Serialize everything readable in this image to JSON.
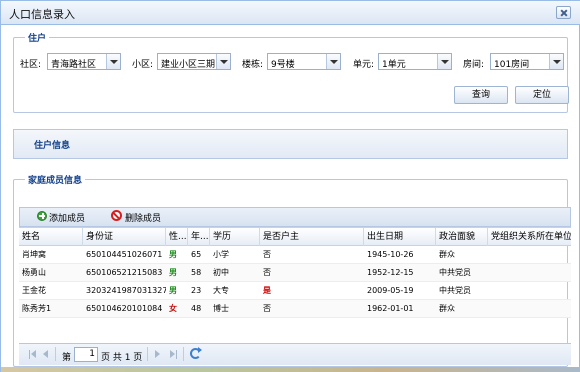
{
  "window": {
    "title": "人口信息录入"
  },
  "household": {
    "legend": "住户",
    "fields": [
      {
        "label": "社区:",
        "value": "青海路社区"
      },
      {
        "label": "小区:",
        "value": "建业小区三期"
      },
      {
        "label": "楼栋:",
        "value": "9号楼"
      },
      {
        "label": "单元:",
        "value": "1单元"
      },
      {
        "label": "房间:",
        "value": "101房间"
      }
    ],
    "query_label": "查询",
    "locate_label": "定位"
  },
  "household_info": {
    "legend": "住户信息"
  },
  "family": {
    "legend": "家庭成员信息",
    "toolbar": {
      "add_label": "添加成员",
      "delete_label": "删除成员"
    },
    "columns": [
      "姓名",
      "身份证",
      "性...",
      "年...",
      "学历",
      "是否户主",
      "出生日期",
      "政治面貌",
      "党组织关系所在单位"
    ],
    "rows": [
      {
        "name": "肖坤窝",
        "id": "650104451026071",
        "gender": "男",
        "age": "65",
        "edu": "小学",
        "head": "否",
        "birth": "1945-10-26",
        "political": "群众",
        "party_unit": ""
      },
      {
        "name": "杨勇山",
        "id": "650106521215083",
        "gender": "男",
        "age": "58",
        "edu": "初中",
        "head": "否",
        "birth": "1952-12-15",
        "political": "中共党员",
        "party_unit": ""
      },
      {
        "name": "王金花",
        "id": "320324198703132762",
        "gender": "男",
        "age": "23",
        "edu": "大专",
        "head": "是",
        "birth": "2009-05-19",
        "political": "中共党员",
        "party_unit": ""
      },
      {
        "name": "陈秀芳1",
        "id": "650104620101084",
        "gender": "女",
        "age": "48",
        "edu": "博士",
        "head": "否",
        "birth": "1962-01-01",
        "political": "群众",
        "party_unit": ""
      }
    ]
  },
  "pager": {
    "page_prefix": "第",
    "current_page": "1",
    "page_suffix": "页 共 1 页"
  },
  "colors": {
    "header_text": "#15428b",
    "male": "#1a8a1a",
    "female": "#c81010",
    "yes": "#d40000"
  }
}
